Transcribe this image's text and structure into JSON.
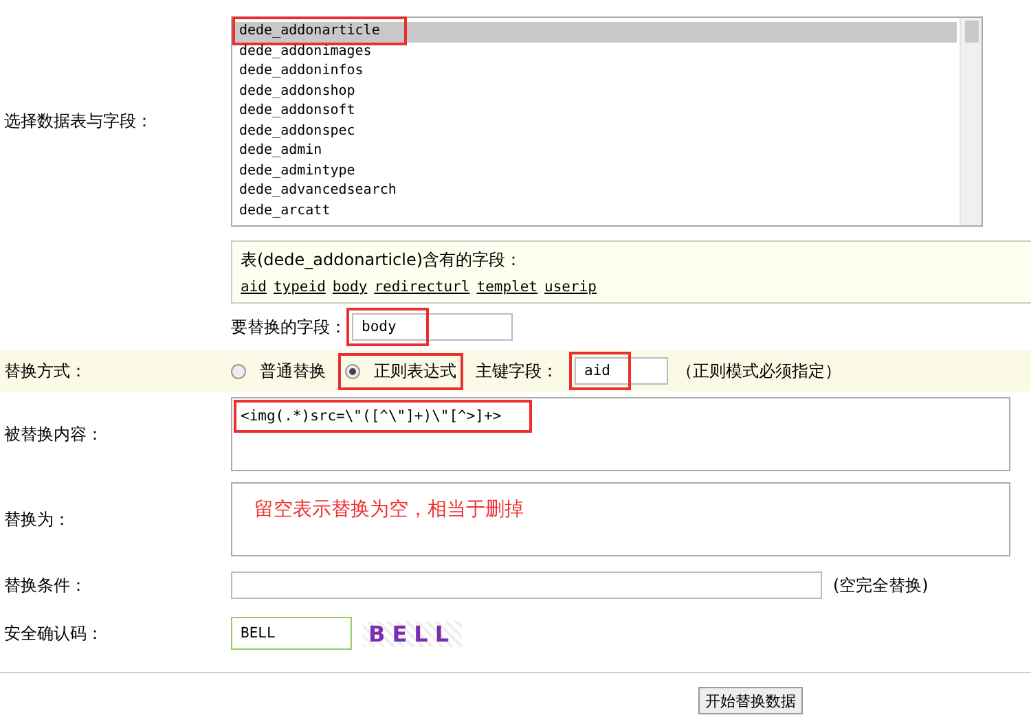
{
  "table_select": {
    "label": "选择数据表与字段：",
    "tables": [
      {
        "name": "dede_addonarticle",
        "selected": true,
        "highlighted": true
      },
      {
        "name": "dede_addonimages",
        "selected": false,
        "highlighted": false
      },
      {
        "name": "dede_addoninfos",
        "selected": false,
        "highlighted": false
      },
      {
        "name": "dede_addonshop",
        "selected": false,
        "highlighted": false
      },
      {
        "name": "dede_addonsoft",
        "selected": false,
        "highlighted": false
      },
      {
        "name": "dede_addonspec",
        "selected": false,
        "highlighted": false
      },
      {
        "name": "dede_admin",
        "selected": false,
        "highlighted": false
      },
      {
        "name": "dede_admintype",
        "selected": false,
        "highlighted": false
      },
      {
        "name": "dede_advancedsearch",
        "selected": false,
        "highlighted": false
      },
      {
        "name": "dede_arcatt",
        "selected": false,
        "highlighted": false
      }
    ]
  },
  "fields_info": {
    "title": "表(dede_addonarticle)含有的字段：",
    "fields": [
      "aid",
      "typeid",
      "body",
      "redirecturl",
      "templet",
      "userip"
    ]
  },
  "replace_field": {
    "label": "要替换的字段：",
    "value": "body",
    "highlighted": true
  },
  "replace_mode": {
    "label": "替换方式：",
    "options": [
      {
        "label": "普通替换",
        "selected": false,
        "highlighted": false
      },
      {
        "label": "正则表达式",
        "selected": true,
        "highlighted": true
      }
    ],
    "key_label": "主键字段：",
    "key_value": "aid",
    "key_highlighted": true,
    "note": "（正则模式必须指定）"
  },
  "search_content": {
    "label": "被替换内容：",
    "value": "<img(.*)src=\\\"([^\\\"]+)\\\"[^>]+>",
    "highlighted": true
  },
  "replace_with": {
    "label": "替换为：",
    "annotation": "留空表示替换为空，相当于删掉"
  },
  "condition": {
    "label": "替换条件：",
    "note": "(空完全替换)"
  },
  "captcha": {
    "label": "安全确认码：",
    "value": "BELL",
    "image_text": "BELL"
  },
  "submit": "开始替换数据"
}
